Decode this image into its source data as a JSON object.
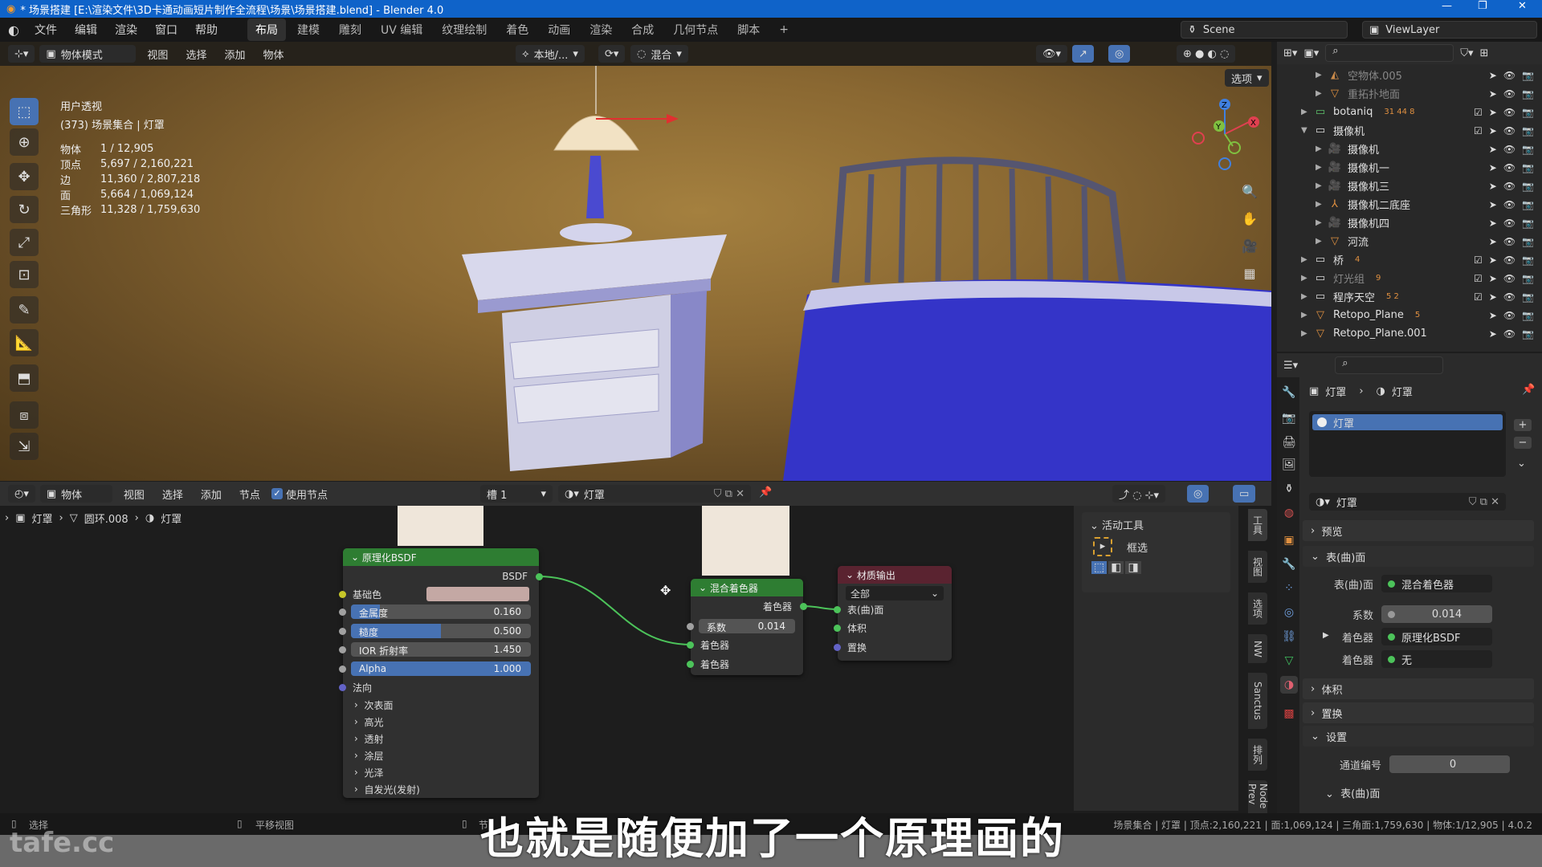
{
  "window": {
    "title": "* 场景搭建 [E:\\渲染文件\\3D卡通动画短片制作全流程\\场景\\场景搭建.blend] - Blender 4.0",
    "app_icon": "blender-icon"
  },
  "menu": {
    "items": [
      "文件",
      "编辑",
      "渲染",
      "窗口",
      "帮助"
    ],
    "workspaces": [
      "布局",
      "建模",
      "雕刻",
      "UV 编辑",
      "纹理绘制",
      "着色",
      "动画",
      "渲染",
      "合成",
      "几何节点",
      "脚本"
    ],
    "active_workspace": "布局",
    "add_tab": "+",
    "scene": "Scene",
    "view_layer": "ViewLayer"
  },
  "viewport_header": {
    "mode": "物体模式",
    "menus": [
      "视图",
      "选择",
      "添加",
      "物体"
    ],
    "orientation": "本地/...",
    "blend": "混合",
    "options": "选项"
  },
  "viewport": {
    "view_name": "用户透视",
    "collection": "(373) 场景集合 | 灯罩",
    "stats": [
      {
        "label": "物体",
        "value": "1 / 12,905"
      },
      {
        "label": "顶点",
        "value": "5,697 / 2,160,221"
      },
      {
        "label": "边",
        "value": "11,360 / 2,807,218"
      },
      {
        "label": "面",
        "value": "5,664 / 1,069,124"
      },
      {
        "label": "三角形",
        "value": "11,328 / 1,759,630"
      }
    ],
    "gizmo_axes": [
      "X",
      "Y",
      "Z"
    ]
  },
  "outliner": {
    "rows": [
      {
        "name": "空物体.005",
        "icon": "empty",
        "dim": true,
        "badges": ""
      },
      {
        "name": "重拓扑地面",
        "icon": "mesh",
        "dim": true,
        "badges": ""
      },
      {
        "name": "botaniq",
        "icon": "collection",
        "dim": false,
        "badges": "31 44 8",
        "checked": true
      },
      {
        "name": "摄像机",
        "icon": "collection",
        "dim": false,
        "badges": "",
        "checked": true,
        "expanded": true
      },
      {
        "name": "摄像机",
        "icon": "camera",
        "dim": false,
        "badges": ""
      },
      {
        "name": "摄像机一",
        "icon": "camera",
        "dim": false,
        "badges": ""
      },
      {
        "name": "摄像机三",
        "icon": "camera",
        "dim": false,
        "badges": ""
      },
      {
        "name": "摄像机二底座",
        "icon": "armature",
        "dim": false,
        "badges": ""
      },
      {
        "name": "摄像机四",
        "icon": "camera",
        "dim": false,
        "badges": ""
      },
      {
        "name": "河流",
        "icon": "mesh",
        "dim": false,
        "badges": ""
      },
      {
        "name": "桥",
        "icon": "collection",
        "dim": false,
        "badges": "4",
        "checked": true
      },
      {
        "name": "灯光组",
        "icon": "collection",
        "dim": true,
        "badges": "9",
        "checked": true
      },
      {
        "name": "程序天空",
        "icon": "collection",
        "dim": false,
        "badges": "5 2",
        "checked": true
      },
      {
        "name": "Retopo_Plane",
        "icon": "mesh",
        "dim": false,
        "badges": "5"
      },
      {
        "name": "Retopo_Plane.001",
        "icon": "mesh",
        "dim": false,
        "badges": ""
      }
    ]
  },
  "properties": {
    "breadcrumb": [
      "灯罩",
      "灯罩"
    ],
    "material_slots": [
      "灯罩"
    ],
    "material_name": "灯罩",
    "sections": {
      "preview": "预览",
      "surface": "表(曲)面",
      "volume": "体积",
      "displacement": "置换",
      "settings": "设置",
      "surface_sub": "表(曲)面"
    },
    "surface_label": "表(曲)面",
    "surface_value": "混合着色器",
    "factor_label": "系数",
    "factor_value": "0.014",
    "shader1_label": "着色器",
    "shader1_value": "原理化BSDF",
    "shader2_label": "着色器",
    "shader2_value": "无",
    "pass_label": "通道编号",
    "pass_value": "0"
  },
  "node_header": {
    "editor_type": "shader-editor",
    "object": "物体",
    "menus": [
      "视图",
      "选择",
      "添加",
      "节点"
    ],
    "use_nodes_label": "使用节点",
    "use_nodes": true,
    "slot": "槽 1",
    "material": "灯罩"
  },
  "node_breadcrumb": [
    "灯罩",
    "圆环.008",
    "灯罩"
  ],
  "nodes": {
    "bsdf": {
      "title": "原理化BSDF",
      "output": "BSDF",
      "base_color_label": "基础色",
      "base_color": "#c4a8a4",
      "sliders": [
        {
          "label": "金属度",
          "value": "0.160",
          "fraction": 0.16
        },
        {
          "label": "糙度",
          "value": "0.500",
          "fraction": 0.5
        },
        {
          "label": "IOR 折射率",
          "value": "1.450",
          "fraction": 0
        },
        {
          "label": "Alpha",
          "value": "1.000",
          "fraction": 1
        }
      ],
      "normal": "法向",
      "panels": [
        "次表面",
        "高光",
        "透射",
        "涂层",
        "光泽",
        "自发光(发射)"
      ]
    },
    "mix": {
      "title": "混合着色器",
      "output": "着色器",
      "factor_label": "系数",
      "factor_value": "0.014",
      "input1": "着色器",
      "input2": "着色器"
    },
    "output": {
      "title": "材质输出",
      "target": "全部",
      "inputs": [
        "表(曲)面",
        "体积",
        "置换"
      ]
    }
  },
  "npanel": {
    "section": "活动工具",
    "tool": "框选",
    "tabs": [
      "工具",
      "视图",
      "选项",
      "NW",
      "Sanctus",
      "排列",
      "Node Prev"
    ]
  },
  "statusbar": {
    "left": [
      "选择",
      "平移视图",
      "节"
    ],
    "right": "场景集合 | 灯罩 | 顶点:2,160,221 | 面:1,069,124 | 三角面:1,759,630 | 物体:1/12,905 | 4.0.2"
  },
  "subtitle": "也就是随便加了一个原理画的",
  "watermark": "tafe.cc",
  "colors": {
    "accent": "#4772b3",
    "title_bar": "#0f63c9",
    "shader_node_header": "#2e7d32",
    "output_node_header": "#5a2330",
    "socket_shader": "#4cc35a"
  }
}
